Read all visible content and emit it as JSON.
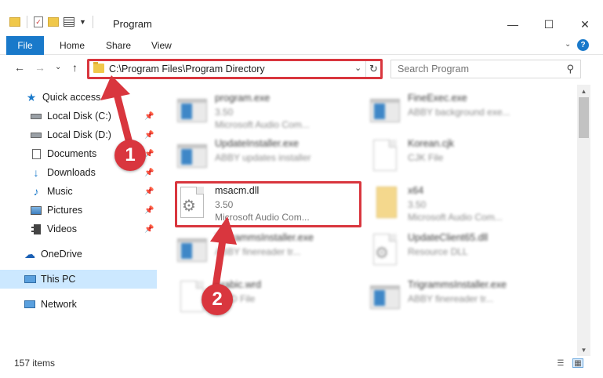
{
  "window": {
    "title": "Program",
    "controls": {
      "minimize": "—",
      "maximize": "☐",
      "close": "✕"
    }
  },
  "ribbon": {
    "tabs": [
      "File",
      "Home",
      "Share",
      "View"
    ],
    "help": "?"
  },
  "navigation": {
    "back": "←",
    "forward": "→",
    "recent": "⌄",
    "up": "↑",
    "address": "C:\\Program Files\\Program Directory",
    "refresh": "↻",
    "search_placeholder": "Search Program"
  },
  "sidebar": {
    "items": [
      {
        "label": "Quick access",
        "icon": "star-icon",
        "pinned": false
      },
      {
        "label": "Local Disk (C:)",
        "icon": "drive-icon",
        "pinned": true
      },
      {
        "label": "Local Disk (D:)",
        "icon": "drive-icon",
        "pinned": true
      },
      {
        "label": "Documents",
        "icon": "documents-icon",
        "pinned": true
      },
      {
        "label": "Downloads",
        "icon": "download-icon",
        "pinned": true
      },
      {
        "label": "Music",
        "icon": "music-icon",
        "pinned": true
      },
      {
        "label": "Pictures",
        "icon": "pictures-icon",
        "pinned": true
      },
      {
        "label": "Videos",
        "icon": "videos-icon",
        "pinned": true
      },
      {
        "label": "OneDrive",
        "icon": "cloud-icon",
        "pinned": false
      },
      {
        "label": "This PC",
        "icon": "computer-icon",
        "pinned": false,
        "selected": true
      },
      {
        "label": "Network",
        "icon": "network-icon",
        "pinned": false
      }
    ]
  },
  "files": [
    {
      "name": "program.exe",
      "meta1": "3.50",
      "meta2": "Microsoft Audio Com...",
      "icon": "exe-icon",
      "blurred": true
    },
    {
      "name": "FineExec.exe",
      "meta1": "ABBY background exe...",
      "meta2": "",
      "icon": "exe-icon",
      "blurred": true
    },
    {
      "name": "UpdateInstaller.exe",
      "meta1": "ABBY updates installer",
      "meta2": "",
      "icon": "exe-icon",
      "blurred": true
    },
    {
      "name": "Korean.cjk",
      "meta1": "CJK File",
      "meta2": "",
      "icon": "document-icon",
      "blurred": true
    },
    {
      "name": "msacm.dll",
      "meta1": "3.50",
      "meta2": "Microsoft Audio Com...",
      "icon": "dll-gear-icon",
      "blurred": false
    },
    {
      "name": "x64",
      "meta1": "3.50",
      "meta2": "Microsoft Audio Com...",
      "icon": "folder-icon",
      "blurred": true
    },
    {
      "name": "TrigrammsInstaller.exe",
      "meta1": "ABBY finereader tr...",
      "meta2": "",
      "icon": "exe-icon",
      "blurred": true
    },
    {
      "name": "UpdateClient65.dll",
      "meta1": "Resource DLL",
      "meta2": "",
      "icon": "dll-gear-icon",
      "blurred": true
    },
    {
      "name": "Arabic.wrd",
      "meta1": "WRD File",
      "meta2": "",
      "icon": "document-icon",
      "blurred": true
    },
    {
      "name": "TrigrammsInstaller.exe",
      "meta1": "ABBY finereader tr...",
      "meta2": "",
      "icon": "exe-icon",
      "blurred": true
    }
  ],
  "annotations": {
    "step1": "1",
    "step2": "2",
    "highlight_color": "#d9363e"
  },
  "status": {
    "item_count": "157 items"
  },
  "colors": {
    "accent": "#1979ca",
    "selection": "#cce8ff"
  }
}
